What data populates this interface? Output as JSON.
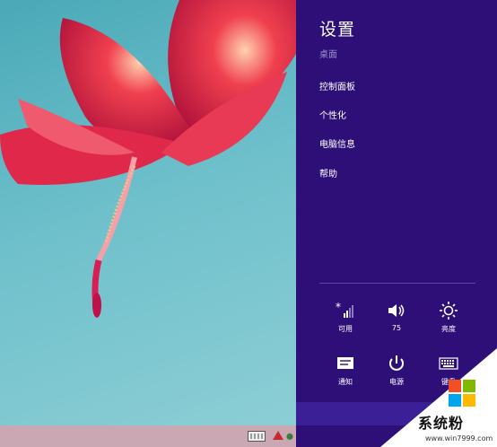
{
  "charm": {
    "title": "设置",
    "subtitle": "桌面",
    "menu": [
      {
        "label": "控制面板"
      },
      {
        "label": "个性化"
      },
      {
        "label": "电脑信息"
      },
      {
        "label": "帮助"
      }
    ],
    "quick": [
      {
        "label": "可用",
        "icon": "wifi-signal-icon"
      },
      {
        "label": "75",
        "icon": "volume-icon"
      },
      {
        "label": "亮度",
        "icon": "brightness-icon"
      },
      {
        "label": "通知",
        "icon": "notifications-icon"
      },
      {
        "label": "电源",
        "icon": "power-icon"
      },
      {
        "label": "键盘",
        "icon": "keyboard-icon"
      }
    ],
    "colors": {
      "background": "#2e0f78",
      "divider": "#5b44a3",
      "subtitle": "#9b8fc6"
    }
  },
  "watermark": {
    "name": "系统粉",
    "url": "www.win7999.com"
  }
}
